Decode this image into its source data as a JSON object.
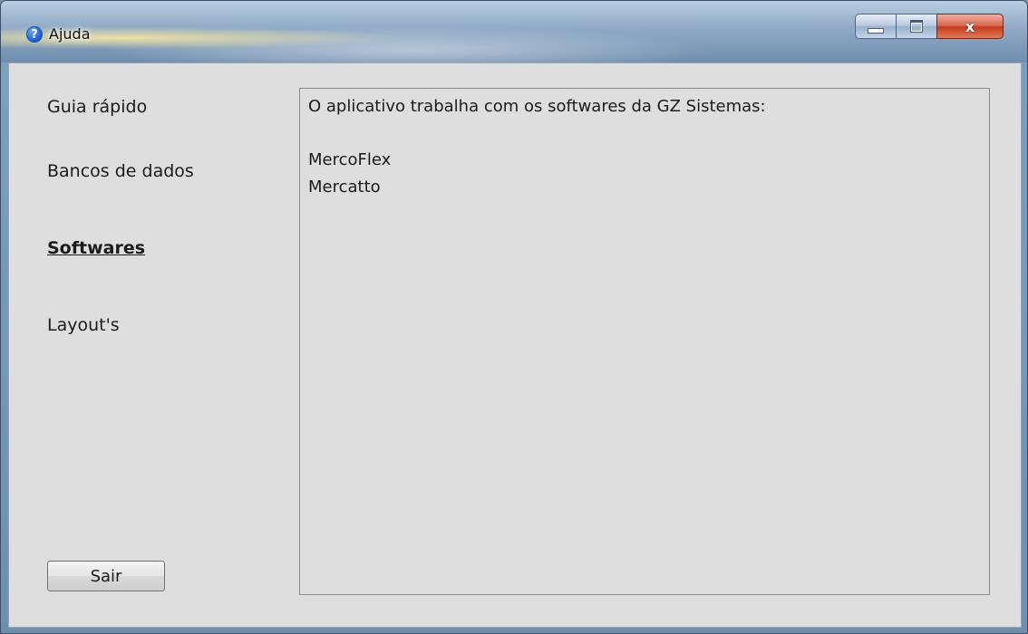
{
  "window": {
    "title": "Ajuda",
    "icon": "help-icon",
    "controls": {
      "minimize": "minimize-icon",
      "maximize": "maximize-icon",
      "close": "x"
    }
  },
  "nav": {
    "items": [
      {
        "label": "Guia rápido",
        "active": false
      },
      {
        "label": "Bancos de dados",
        "active": false
      },
      {
        "label": "Softwares",
        "active": true
      },
      {
        "label": "Layout's",
        "active": false
      }
    ]
  },
  "content": {
    "lines": [
      "O aplicativo trabalha com os softwares da GZ Sistemas:",
      "MercoFlex",
      "Mercatto"
    ]
  },
  "footer": {
    "exit_label": "Sair"
  },
  "colors": {
    "client_bg": "#dedede",
    "close_button": "#c53b1f",
    "title_bar": "#8fa9c5"
  }
}
